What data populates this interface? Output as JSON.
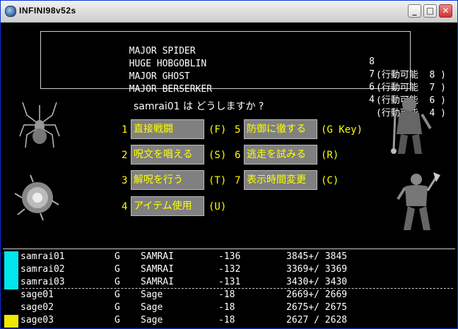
{
  "window": {
    "title": "INFINI98v52s"
  },
  "enemies": [
    {
      "name": "MAJOR SPIDER",
      "count": "8",
      "action": "(行動可能  8 )"
    },
    {
      "name": "HUGE HOBGOBLIN",
      "count": "7",
      "action": "(行動可能  7 )"
    },
    {
      "name": "MAJOR GHOST",
      "count": "6",
      "action": "(行動可能  6 )"
    },
    {
      "name": "MAJOR BERSERKER",
      "count": "4",
      "action": "(行動可能  4 )"
    }
  ],
  "prompt": "samrai01 は どうしますか ?",
  "commands": [
    {
      "num": "1",
      "label": "直接戦闘",
      "key": "(F)"
    },
    {
      "num": "2",
      "label": "呪文を唱える",
      "key": "(S)"
    },
    {
      "num": "3",
      "label": "解呪を行う",
      "key": "(T)"
    },
    {
      "num": "4",
      "label": "アイテム使用",
      "key": "(U)"
    },
    {
      "num": "5",
      "label": "防御に徹する",
      "key": "(G Key)"
    },
    {
      "num": "6",
      "label": "逃走を試みる",
      "key": "(R)"
    },
    {
      "num": "7",
      "label": "表示時間変更",
      "key": "(C)"
    }
  ],
  "party": [
    {
      "name": "samrai01",
      "align": "G",
      "class": "SAMRAI",
      "ac": "-136",
      "hp": "3845+/ 3845",
      "color": "#00e5ee"
    },
    {
      "name": "samrai02",
      "align": "G",
      "class": "SAMRAI",
      "ac": "-132",
      "hp": "3369+/ 3369",
      "color": "#00e5ee"
    },
    {
      "name": "samrai03",
      "align": "G",
      "class": "SAMRAI",
      "ac": "-131",
      "hp": "3430+/ 3430",
      "color": "#00e5ee"
    },
    {
      "name": "sage01",
      "align": "G",
      "class": "Sage",
      "ac": "-18",
      "hp": "2669+/ 2669",
      "color": "#000000"
    },
    {
      "name": "sage02",
      "align": "G",
      "class": "Sage",
      "ac": "-18",
      "hp": "2675+/ 2675",
      "color": "#000000"
    },
    {
      "name": "sage03",
      "align": "G",
      "class": "Sage",
      "ac": "-18",
      "hp": "2627 / 2628",
      "color": "#f0e800"
    }
  ],
  "monsters": [
    "spider-icon",
    "ghost-icon",
    "hobgoblin-icon",
    "berserker-icon"
  ]
}
